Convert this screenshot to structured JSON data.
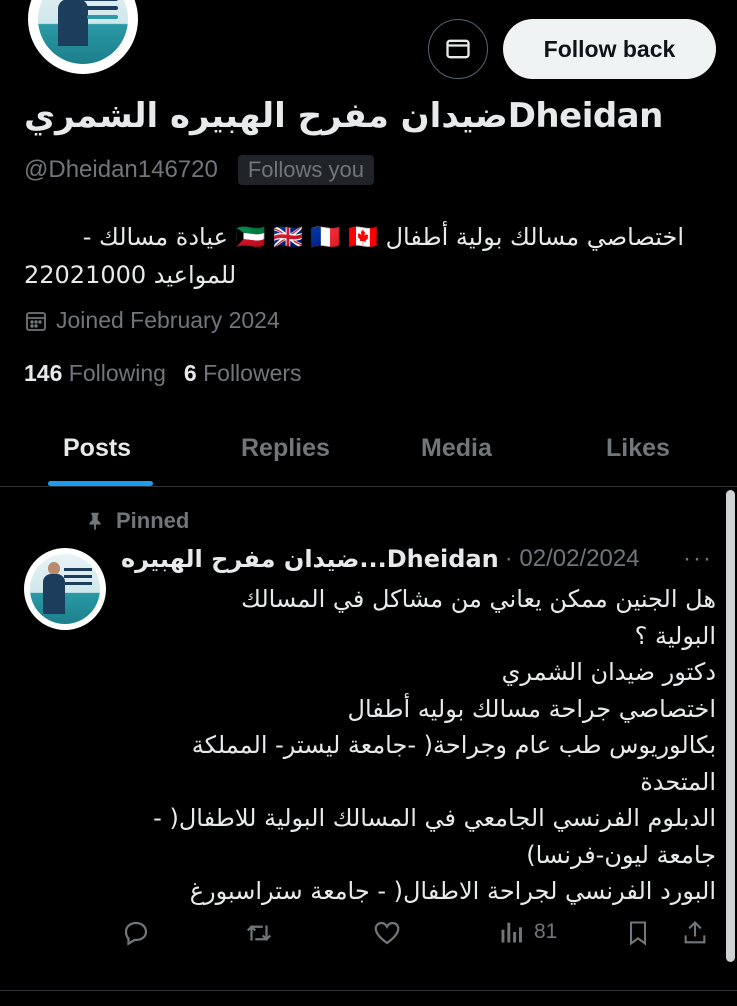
{
  "profile": {
    "display_name": "ضيدان مفرح الهبيره الشمريDheidan",
    "handle": "@Dheidan146720",
    "follows_you": "Follows you",
    "bio_line1": "اختصاصي مسالك بولية أطفال 🇰🇼 🇬🇧 🇫🇷 🇨🇦 عيادة مسالك -",
    "bio_line2": "للمواعيد 22021000",
    "joined": "Joined February 2024",
    "following_count": "146",
    "following_label": "Following",
    "followers_count": "6",
    "followers_label": "Followers"
  },
  "buttons": {
    "follow_back": "Follow back"
  },
  "tabs": [
    {
      "label": "Posts",
      "active": true
    },
    {
      "label": "Replies",
      "active": false
    },
    {
      "label": "Media",
      "active": false
    },
    {
      "label": "Likes",
      "active": false
    }
  ],
  "post": {
    "pinned_label": "Pinned",
    "author": "ضيدان مفرح الهبيره...Dheidan",
    "date": "· 02/02/2024",
    "more": "···",
    "lines": [
      "هل الجنين ممكن يعاني من مشاكل في المسالك",
      "البولية ؟",
      "دكتور ضيدان الشمري",
      "اختصاصي جراحة مسالك بوليه أطفال",
      "بكالوريوس طب عام وجراحة( -جامعة ليستر- المملكة",
      "المتحدة",
      "الدبلوم الفرنسي الجامعي في المسالك البولية للاطفال( -",
      "جامعة ليون-فرنسا)",
      "البورد الفرنسي لجراحة الاطفال( - جامعة ستراسبورغ"
    ],
    "views": "81"
  },
  "colors": {
    "background": "#000000",
    "text_primary": "#e7e9ea",
    "text_secondary": "#71767b",
    "accent": "#1d9bf0",
    "button_light": "#eff3f4"
  }
}
